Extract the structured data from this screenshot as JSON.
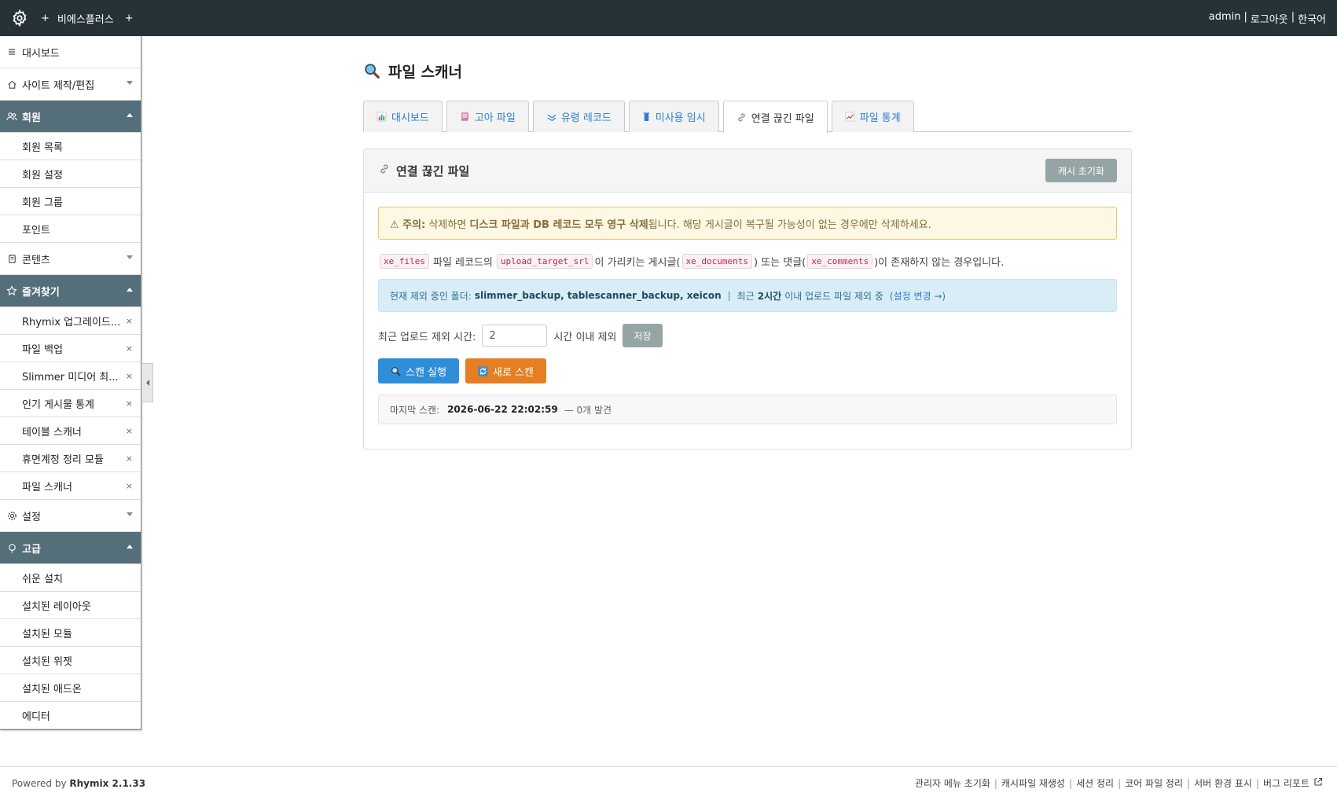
{
  "topbar": {
    "site": "비에스플러스",
    "plus": "+",
    "user": "admin",
    "logout": "로그아웃",
    "lang": "한국어",
    "sep": "|"
  },
  "sidebar": [
    {
      "label": "대시보드",
      "icon": "menu-icon",
      "open": false,
      "caret": false,
      "items": []
    },
    {
      "label": "사이트 제작/편집",
      "icon": "home-icon",
      "open": false,
      "caret": true,
      "items": []
    },
    {
      "label": "회원",
      "icon": "users-icon",
      "open": true,
      "caret": true,
      "items": [
        {
          "label": "회원 목록"
        },
        {
          "label": "회원 설정"
        },
        {
          "label": "회원 그룹"
        },
        {
          "label": "포인트"
        }
      ]
    },
    {
      "label": "콘텐츠",
      "icon": "document-icon",
      "open": false,
      "caret": true,
      "items": []
    },
    {
      "label": "즐겨찾기",
      "icon": "star-icon",
      "open": true,
      "caret": true,
      "items": [
        {
          "label": "Rhymix 업그레이드...",
          "x": "×"
        },
        {
          "label": "파일 백업",
          "x": "×"
        },
        {
          "label": "Slimmer 미디어 최...",
          "x": "×"
        },
        {
          "label": "인기 게시물 통계",
          "x": "×"
        },
        {
          "label": "테이블 스캐너",
          "x": "×"
        },
        {
          "label": "휴면계정 정리 모듈",
          "x": "×"
        },
        {
          "label": "파일 스캐너",
          "x": "×"
        }
      ]
    },
    {
      "label": "설정",
      "icon": "gear-icon",
      "open": false,
      "caret": true,
      "items": []
    },
    {
      "label": "고급",
      "icon": "bulb-icon",
      "open": true,
      "caret": true,
      "items": [
        {
          "label": "쉬운 설치"
        },
        {
          "label": "설치된 레이아웃"
        },
        {
          "label": "설치된 모듈"
        },
        {
          "label": "설치된 위젯"
        },
        {
          "label": "설치된 애드온"
        },
        {
          "label": "에디터"
        }
      ]
    }
  ],
  "page": {
    "title": "파일 스캐너"
  },
  "tabs": [
    {
      "label": "대시보드",
      "icon": "bar-chart-icon",
      "active": false
    },
    {
      "label": "고아 파일",
      "icon": "broken-file-icon",
      "active": false
    },
    {
      "label": "유령 레코드",
      "icon": "ghost-icon",
      "active": false
    },
    {
      "label": "미사용 임시",
      "icon": "trash-icon",
      "active": false
    },
    {
      "label": "연결 끊긴 파일",
      "icon": "link-icon",
      "active": true
    },
    {
      "label": "파일 통계",
      "icon": "line-chart-icon",
      "active": false
    }
  ],
  "panel": {
    "title": "연결 끊긴 파일",
    "reset_cache": "캐시 초기화",
    "warning": {
      "prefix": "⚠ 주의:",
      "text1": " 삭제하면 ",
      "bold": "디스크 파일과 DB 레코드 모두 영구 삭제",
      "text2": "됩니다. 해당 게시글이 복구될 가능성이 없는 경우에만 삭제하세요."
    },
    "desc": {
      "code1": "xe_files",
      "t1": "파일 레코드의",
      "code2": "upload_target_srl",
      "t2": "이 가리키는 게시글(",
      "code3": "xe_documents",
      "t3": ") 또는 댓글(",
      "code4": "xe_comments",
      "t4": ")이 존재하지 않는 경우입니다."
    },
    "info": {
      "label": "현재 제외 중인 폴더:",
      "folders": "slimmer_backup, tablescanner_backup, xeicon",
      "sep": "|",
      "recent": "최근",
      "hours": "2시간",
      "rest": "이내 업로드 파일 제외 중",
      "link": "(설정 변경 →)"
    },
    "form": {
      "label": "최근 업로드 제외 시간:",
      "value": "2",
      "suffix": "시간 이내 제외",
      "save": "저장"
    },
    "scan_button": "스캔 실행",
    "rescan_button": "새로 스캔",
    "last_scan": {
      "label": "마지막 스캔:",
      "datetime": "2026-06-22 22:02:59",
      "result": "— 0개 발견"
    }
  },
  "footer": {
    "powered": "Powered by",
    "brand": "Rhymix 2.1.33",
    "links": [
      "관리자 메뉴 초기화",
      "캐시파일 재생성",
      "세션 정리",
      "코어 파일 정리",
      "서버 환경 표시",
      "버그 리포트"
    ]
  },
  "colors": {
    "topbar": "#263238",
    "sidebar_open": "#546e7a",
    "primary": "#2e8ed8",
    "orange": "#e67e22",
    "gray_button": "#95a5a6"
  }
}
